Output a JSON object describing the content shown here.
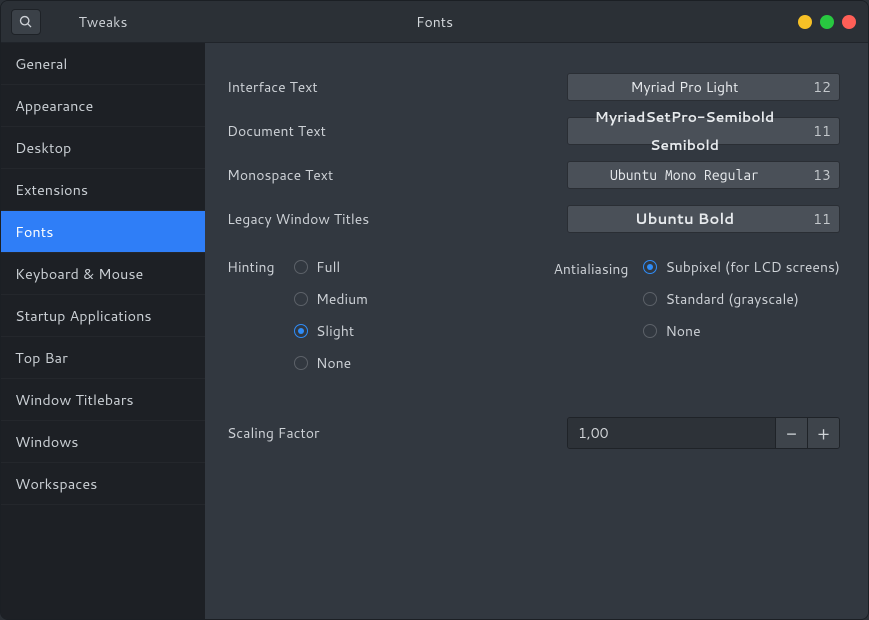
{
  "window": {
    "app_title": "Tweaks",
    "page_title": "Fonts"
  },
  "sidebar": {
    "items": [
      {
        "label": "General"
      },
      {
        "label": "Appearance"
      },
      {
        "label": "Desktop"
      },
      {
        "label": "Extensions"
      },
      {
        "label": "Fonts",
        "selected": true
      },
      {
        "label": "Keyboard & Mouse"
      },
      {
        "label": "Startup Applications"
      },
      {
        "label": "Top Bar"
      },
      {
        "label": "Window Titlebars"
      },
      {
        "label": "Windows"
      },
      {
        "label": "Workspaces"
      }
    ]
  },
  "fonts": {
    "rows": [
      {
        "label": "Interface Text",
        "font": "Myriad Pro Light",
        "size": "12",
        "style": ""
      },
      {
        "label": "Document Text",
        "font": "MyriadSetPro-Semibold Semibold",
        "size": "11",
        "style": "semi"
      },
      {
        "label": "Monospace Text",
        "font": "Ubuntu Mono Regular",
        "size": "13",
        "style": "mono"
      },
      {
        "label": "Legacy Window Titles",
        "font": "Ubuntu Bold",
        "size": "11",
        "style": "bold"
      }
    ],
    "hinting": {
      "label": "Hinting",
      "options": [
        "Full",
        "Medium",
        "Slight",
        "None"
      ],
      "selected": "Slight"
    },
    "antialiasing": {
      "label": "Antialiasing",
      "options": [
        "Subpixel (for LCD screens)",
        "Standard (grayscale)",
        "None"
      ],
      "selected": "Subpixel (for LCD screens)"
    },
    "scaling": {
      "label": "Scaling Factor",
      "value": "1,00",
      "minus": "−",
      "plus": "+"
    }
  }
}
